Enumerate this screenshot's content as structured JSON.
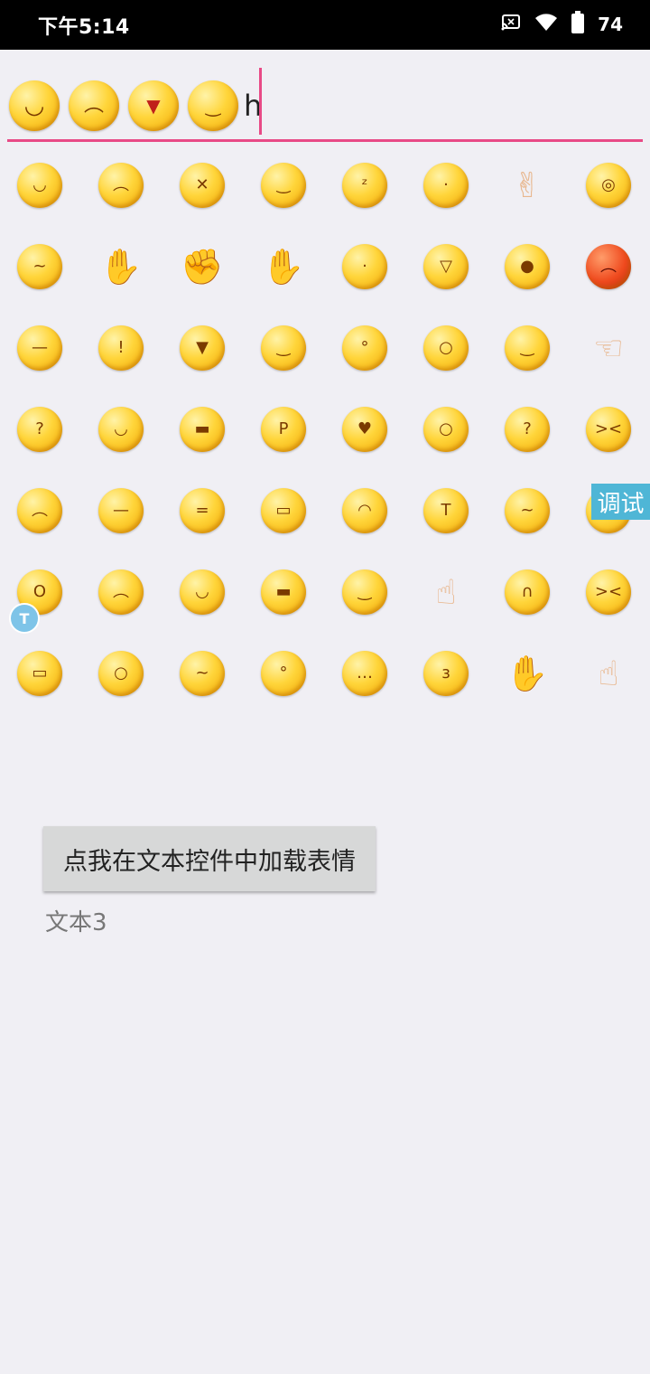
{
  "status_bar": {
    "time": "下午5:14",
    "battery": "74",
    "icons": [
      "cast-icon",
      "wifi-icon",
      "battery-icon"
    ]
  },
  "editor": {
    "emojis": [
      "grin",
      "frown",
      "angry-drool",
      "shy-smile"
    ],
    "typed_text": "h",
    "accent_color": "#e84a86"
  },
  "emoji_grid": [
    [
      "grin",
      "frown",
      "taped-mouth",
      "smirk",
      "sleepy",
      "sweat-look",
      "victory-hand",
      "dizzy"
    ],
    [
      "worried",
      "handshake-hand",
      "fist-hand",
      "clap-hand",
      "shush",
      "laugh-hands",
      "lip-bite",
      "angry-red"
    ],
    [
      "meh",
      "shush-finger",
      "angry-drool",
      "shy-smile",
      "blush-cry",
      "sob-eyes",
      "shy-turn",
      "hand-point-left"
    ],
    [
      "puzzled",
      "giggle-hand",
      "cool-sunglasses",
      "tongue-wink",
      "heart-eyes",
      "blush-stare",
      "confused-question",
      "squint-smile"
    ],
    [
      "sad-hands",
      "ninja-headband",
      "sweat-smile",
      "big-grin",
      "cover-face",
      "hammer-hit",
      "cry-hands",
      "hug"
    ],
    [
      "shock",
      "pout",
      "smile",
      "cool-smile",
      "tilt-smile",
      "index-finger-hand",
      "crying-tears",
      "laugh-sweat"
    ],
    [
      "teeth-grin",
      "wide-eyes",
      "anxious-cry",
      "daze",
      "think",
      "kiss",
      "ok-hand",
      "point-up-hand"
    ]
  ],
  "debug_tag": "调试",
  "float_ball_label": "T",
  "load_button": "点我在文本控件中加载表情",
  "text3": "文本3"
}
